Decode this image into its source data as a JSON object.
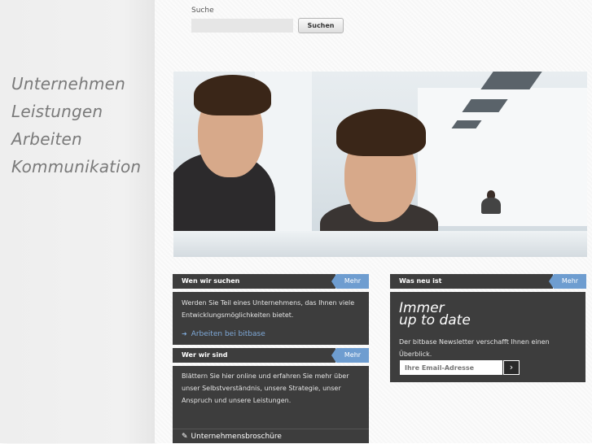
{
  "nav": {
    "items": [
      "Unternehmen",
      "Leistungen",
      "Arbeiten",
      "Kommunikation"
    ]
  },
  "search": {
    "label": "Suche",
    "placeholder": "",
    "button_label": "Suchen"
  },
  "boxes": {
    "wen_wir_suchen": {
      "title": "Wen wir suchen",
      "more_label": "Mehr",
      "text": "Werden Sie Teil eines Unternehmens, das Ihnen viele Entwicklungsmöglichkeiten bietet.",
      "link_label": "Arbeiten bei bitbase"
    },
    "wer_wir_sind": {
      "title": "Wer wir sind",
      "more_label": "Mehr",
      "text": "Blättern Sie hier online und erfahren Sie mehr über unser Selbstverständnis, unsere Strategie, unser Anspruch und unsere Leistungen.",
      "brochure_label": "Unternehmensbroschüre"
    },
    "was_neu_ist": {
      "title": "Was neu ist",
      "more_label": "Mehr",
      "slogan_line1": "Immer",
      "slogan_line2": "up to date",
      "text": "Der bitbase Newsletter verschafft Ihnen einen Überblick.",
      "email_placeholder": "Ihre Email-Adresse"
    }
  },
  "colors": {
    "accent_blue": "#6e9dd0",
    "box_dark": "#3d3d3d",
    "nav_gray": "#7a7a7a"
  },
  "icons": {
    "arrow": "arrow-right-icon",
    "email_go": "chevron-right-icon",
    "brochure": "document-edit-icon"
  }
}
